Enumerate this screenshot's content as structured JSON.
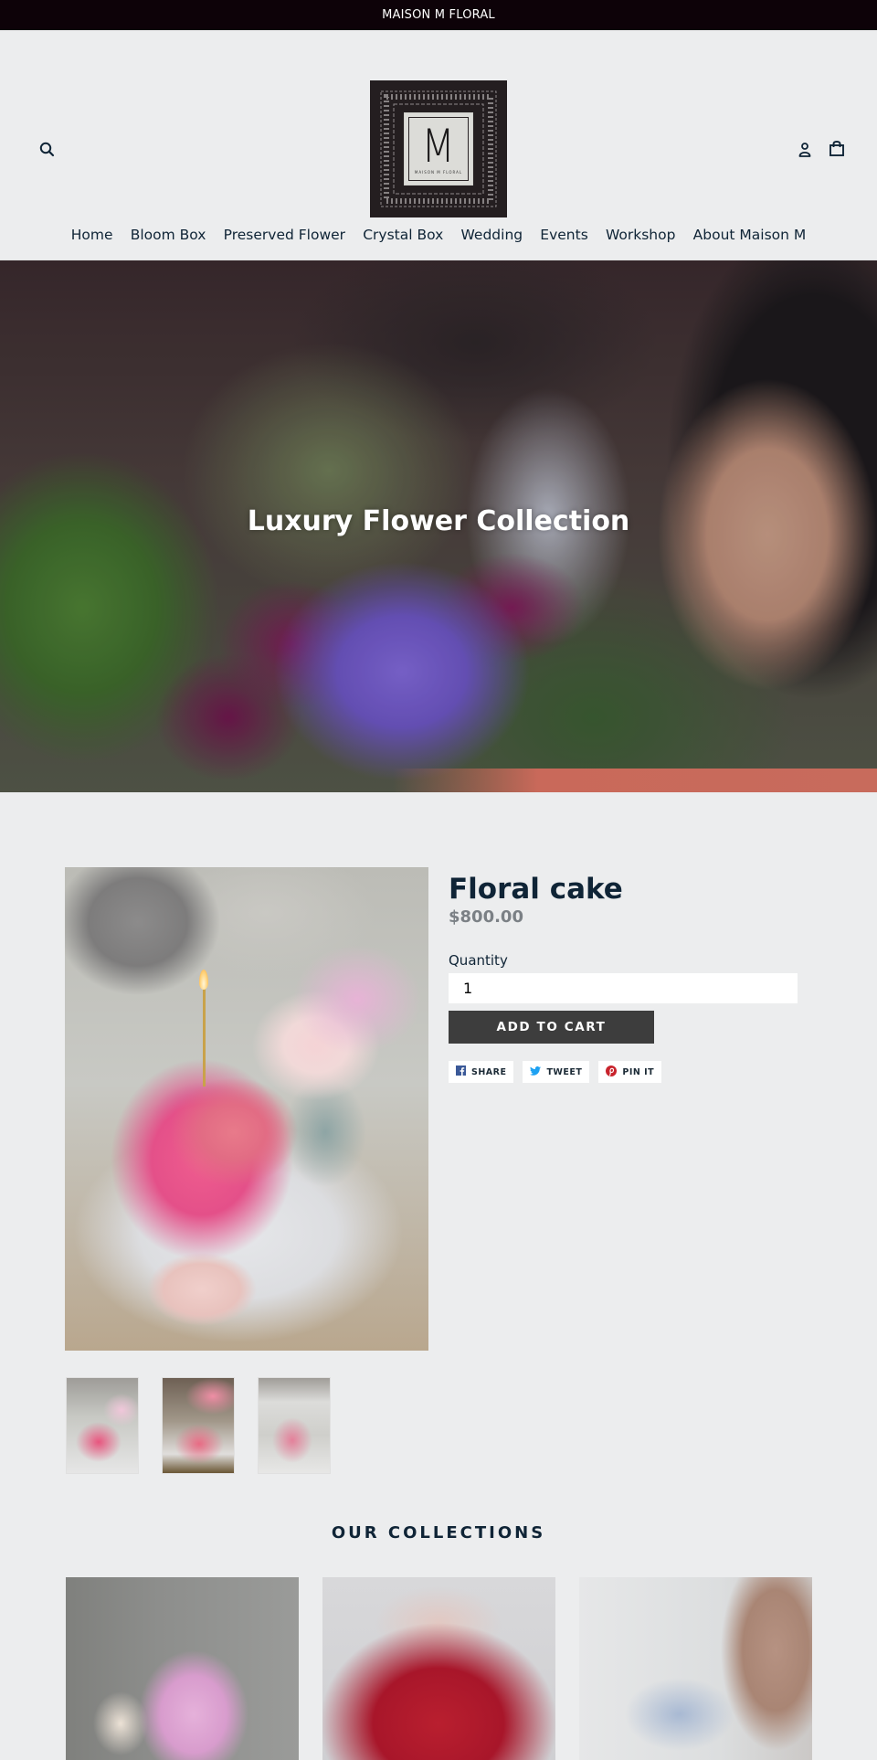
{
  "announcement": "MAISON M FLORAL",
  "header": {
    "logo": {
      "letter": "M",
      "tagline": "MAISON M FLORAL"
    },
    "icons": {
      "search": "search-icon",
      "account": "account-icon",
      "cart": "cart-icon"
    },
    "nav": [
      {
        "label": "Home"
      },
      {
        "label": "Bloom Box"
      },
      {
        "label": "Preserved Flower"
      },
      {
        "label": "Crystal Box"
      },
      {
        "label": "Wedding"
      },
      {
        "label": "Events"
      },
      {
        "label": "Workshop"
      },
      {
        "label": "About Maison M"
      }
    ]
  },
  "hero": {
    "title": "Luxury Flower Collection"
  },
  "product": {
    "title": "Floral cake",
    "price": "$800.00",
    "quantity_label": "Quantity",
    "quantity_value": "1",
    "add_to_cart": "ADD TO CART",
    "thumbnails_count": 3,
    "share": [
      {
        "label": "SHARE",
        "icon": "facebook-icon",
        "color": "#3b5998"
      },
      {
        "label": "TWEET",
        "icon": "twitter-icon",
        "color": "#1da1f2"
      },
      {
        "label": "PIN IT",
        "icon": "pinterest-icon",
        "color": "#c8232c"
      }
    ]
  },
  "collections": {
    "heading": "OUR COLLECTIONS"
  },
  "colors": {
    "announcement_bg": "#0d0208",
    "page_bg": "#ecedee",
    "text": "#0f2436",
    "price": "#7b8085",
    "button_bg": "#3d3d3d"
  }
}
